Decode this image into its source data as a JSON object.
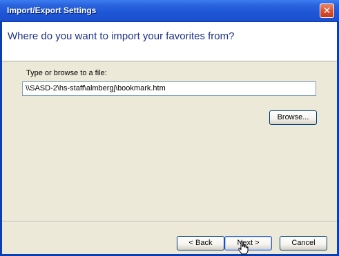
{
  "window": {
    "title": "Import/Export Settings",
    "close_glyph": "✕"
  },
  "header": {
    "prompt": "Where do you want to import your favorites from?"
  },
  "form": {
    "file_label": "Type or browse to a file:",
    "file_path": "\\\\SASD-2\\hs-staff\\almbergj\\bookmark.htm",
    "browse_label": "Browse..."
  },
  "footer": {
    "back_label": "< Back",
    "next_label": "Next >",
    "cancel_label": "Cancel"
  },
  "colors": {
    "titlebar": "#2a63dd",
    "header_text": "#1e3287",
    "panel": "#ece9d8",
    "close_button": "#d9502e"
  },
  "icons": {
    "close": "close-icon",
    "cursor": "hand-pointer-cursor"
  }
}
